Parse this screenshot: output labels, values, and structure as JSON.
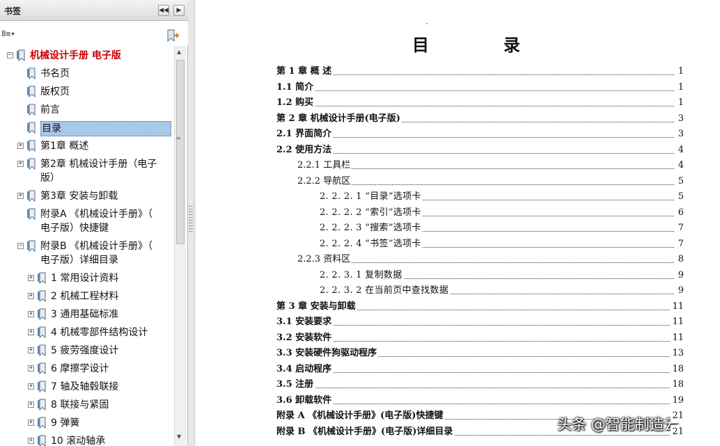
{
  "panel": {
    "title": "书签",
    "collapse_glyph": "◀◀",
    "next_glyph": "▶",
    "options_glyph": "8≡▾",
    "accent": "#cc0000",
    "selection": "#a8c8e8"
  },
  "bookmarks": [
    {
      "label": "机械设计手册 电子版",
      "level": 0,
      "exp": "−",
      "root": true
    },
    {
      "label": "书名页",
      "level": 1,
      "exp": ""
    },
    {
      "label": "版权页",
      "level": 1,
      "exp": ""
    },
    {
      "label": "前言",
      "level": 1,
      "exp": ""
    },
    {
      "label": "目录",
      "level": 1,
      "exp": "",
      "selected": true
    },
    {
      "label": "第1章  概述",
      "level": 1,
      "exp": "+"
    },
    {
      "label": "第2章  机械设计手册（电子",
      "label2": "版）",
      "level": 1,
      "exp": "+"
    },
    {
      "label": "第3章  安装与卸载",
      "level": 1,
      "exp": "+"
    },
    {
      "label": "附录A 《机械设计手册》（",
      "label2": "电子版）快捷键",
      "level": 1,
      "exp": ""
    },
    {
      "label": "附录B 《机械设计手册》（",
      "label2": "电子版）详细目录",
      "level": 1,
      "exp": "−"
    },
    {
      "label": "1  常用设计资料",
      "level": 2,
      "exp": "+"
    },
    {
      "label": "2  机械工程材料",
      "level": 2,
      "exp": "+"
    },
    {
      "label": "3  通用基础标准",
      "level": 2,
      "exp": "+"
    },
    {
      "label": "4  机械零部件结构设计",
      "level": 2,
      "exp": "+"
    },
    {
      "label": "5  疲劳强度设计",
      "level": 2,
      "exp": "+"
    },
    {
      "label": "6  摩擦学设计",
      "level": 2,
      "exp": "+"
    },
    {
      "label": "7  轴及轴毂联接",
      "level": 2,
      "exp": "+"
    },
    {
      "label": "8  联接与紧固",
      "level": 2,
      "exp": "+"
    },
    {
      "label": "9  弹簧",
      "level": 2,
      "exp": "+"
    },
    {
      "label": "10  滚动轴承",
      "level": 2,
      "exp": "+"
    }
  ],
  "scrollbar": {
    "up": "▲",
    "down": "▼",
    "grip": "≡"
  },
  "document": {
    "title_a": "目",
    "title_b": "录",
    "toc": [
      {
        "text": "第 1 章  概    述",
        "page": "1",
        "level": 1
      },
      {
        "text": "1.1  简介",
        "page": "1",
        "level": 1
      },
      {
        "text": "1.2  购买",
        "page": "1",
        "level": 1
      },
      {
        "text": "第 2 章  机械设计手册(电子版)",
        "page": "3",
        "level": 1
      },
      {
        "text": "2.1  界面简介",
        "page": "3",
        "level": 1
      },
      {
        "text": "2.2  使用方法",
        "page": "4",
        "level": 1
      },
      {
        "text": "2.2.1  工具栏",
        "page": "4",
        "level": 2
      },
      {
        "text": "2.2.2  导航区",
        "page": "5",
        "level": 2
      },
      {
        "text": "2. 2. 2. 1  “目录”选项卡",
        "page": "5",
        "level": 3
      },
      {
        "text": "2. 2. 2. 2  “索引”选项卡",
        "page": "6",
        "level": 3
      },
      {
        "text": "2. 2. 2. 3  “搜索”选项卡",
        "page": "7",
        "level": 3
      },
      {
        "text": "2. 2. 2. 4  “书签”选项卡",
        "page": "7",
        "level": 3
      },
      {
        "text": "2.2.3  资料区",
        "page": "8",
        "level": 2
      },
      {
        "text": "2. 2. 3. 1  复制数据",
        "page": "9",
        "level": 3
      },
      {
        "text": "2. 2. 3. 2  在当前页中查找数据",
        "page": "9",
        "level": 3
      },
      {
        "text": "第 3 章  安装与卸载",
        "page": "11",
        "level": 1
      },
      {
        "text": "3.1  安装要求",
        "page": "11",
        "level": 1
      },
      {
        "text": "3.2  安装软件",
        "page": "11",
        "level": 1
      },
      {
        "text": "3.3  安装硬件狗驱动程序",
        "page": "13",
        "level": 1
      },
      {
        "text": "3.4  启动程序",
        "page": "18",
        "level": 1
      },
      {
        "text": "3.5  注册",
        "page": "18",
        "level": 1
      },
      {
        "text": "3.6  卸载软件",
        "page": "19",
        "level": 1
      },
      {
        "text": "附录 A  《机械设计手册》(电子版)快捷键",
        "page": "21",
        "level": 1
      },
      {
        "text": "附录 B  《机械设计手册》(电子版)详细目录",
        "page": "21",
        "level": 1
      }
    ]
  },
  "watermark": "头条 @智能制造云"
}
